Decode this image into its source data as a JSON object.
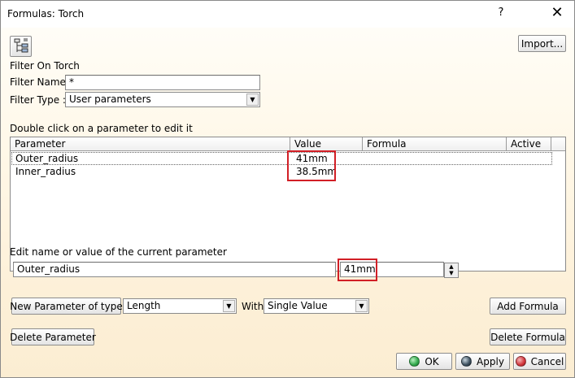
{
  "window": {
    "title": "Formulas: Torch",
    "help_label": "?",
    "close_label": "✕"
  },
  "toolbar": {
    "import_label": "Import..."
  },
  "filter": {
    "heading": "Filter On Torch",
    "name_label": "Filter Name :",
    "name_value": "*",
    "type_label": "Filter Type :",
    "type_value": "User parameters"
  },
  "parameters": {
    "heading": "Double click on a parameter to edit it",
    "columns": [
      "Parameter",
      "Value",
      "Formula",
      "Active"
    ],
    "rows": [
      {
        "parameter": "Outer_radius",
        "value": "41mm",
        "formula": "",
        "active": ""
      },
      {
        "parameter": "Inner_radius",
        "value": "38.5mm",
        "formula": "",
        "active": ""
      }
    ]
  },
  "edit": {
    "heading": "Edit name or value of the current parameter",
    "name_value": "Outer_radius",
    "value_value": "41mm"
  },
  "new_param": {
    "button_label": "New Parameter of type",
    "type_value": "Length",
    "with_label": "With",
    "with_value": "Single Value",
    "add_formula_label": "Add Formula"
  },
  "actions": {
    "delete_parameter_label": "Delete Parameter",
    "delete_formula_label": "Delete Formula",
    "ok_label": "OK",
    "apply_label": "Apply",
    "cancel_label": "Cancel"
  },
  "colors": {
    "highlight": "#d21f26",
    "ok_dot": "#2fa84a",
    "apply_dot": "#3a4d5c",
    "cancel_dot": "#d2343a"
  },
  "icons": {
    "filter_tool": "filter-tree-icon",
    "close": "close-icon",
    "spin": "spinner-arrows-icon"
  }
}
